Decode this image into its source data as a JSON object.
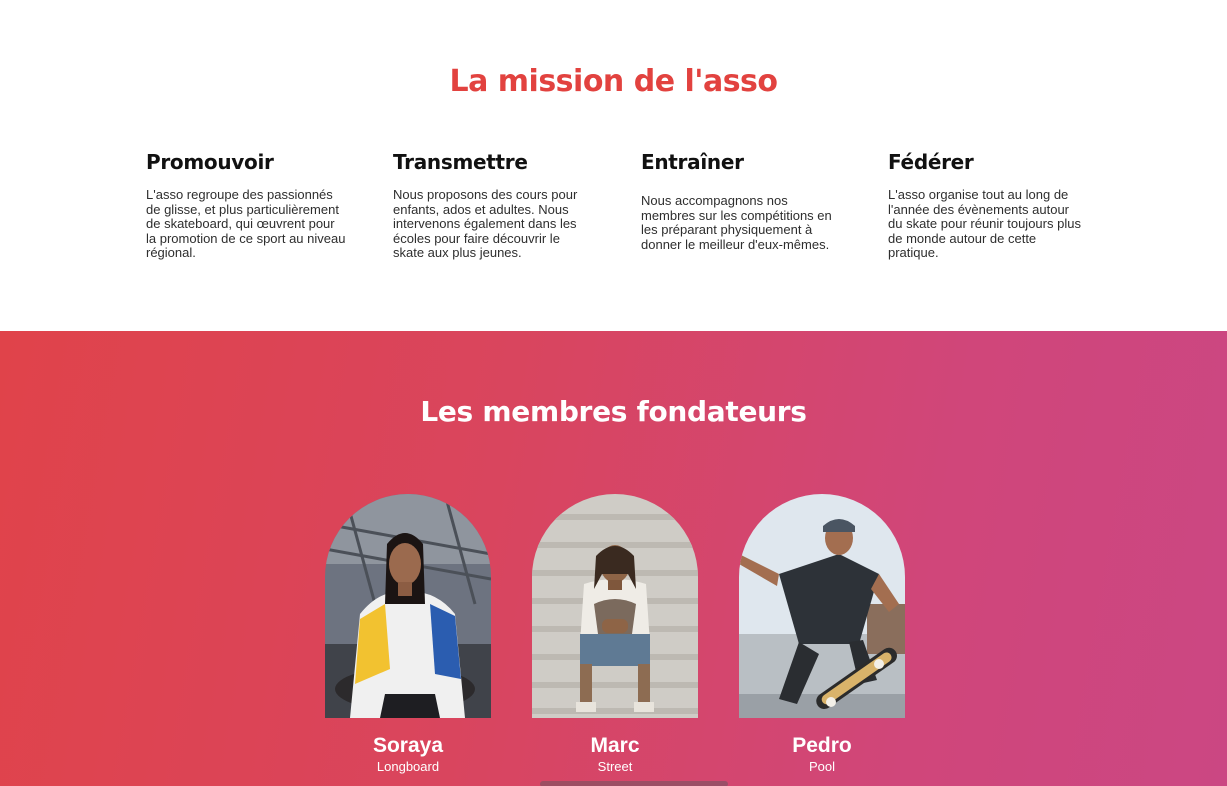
{
  "mission": {
    "title": "La mission de l'asso",
    "columns": [
      {
        "heading": "Promouvoir",
        "text": "L'asso regroupe des passionnés de glisse, et plus particulièrement de skateboard, qui œuvrent pour la promotion de ce sport au niveau régional."
      },
      {
        "heading": "Transmettre",
        "text": "Nous proposons des cours pour enfants, ados et adultes. Nous intervenons également dans les écoles pour faire découvrir le skate aux plus jeunes."
      },
      {
        "heading": "Entraîner",
        "text": "Nous accompagnons nos membres sur les compétitions en les préparant physiquement à donner le meilleur d'eux-mêmes."
      },
      {
        "heading": "Fédérer",
        "text": "L'asso organise tout au long de l'année des évènements autour du skate pour réunir toujours plus de monde autour de cette pratique."
      }
    ]
  },
  "founders": {
    "title": "Les membres fondateurs",
    "members": [
      {
        "name": "Soraya",
        "discipline": "Longboard"
      },
      {
        "name": "Marc",
        "discipline": "Street"
      },
      {
        "name": "Pedro",
        "discipline": "Pool"
      }
    ]
  },
  "colors": {
    "accent": "#e2423f",
    "gradient_start": "#e0434a",
    "gradient_end": "#cb4783"
  }
}
